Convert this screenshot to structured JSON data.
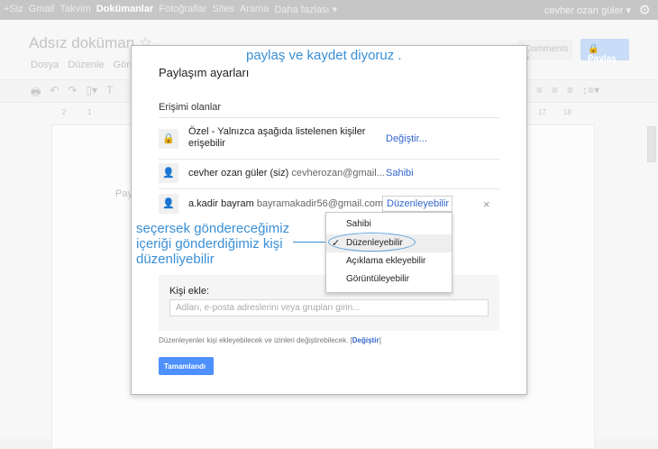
{
  "topbar": {
    "items": [
      "+Siz",
      "Gmail",
      "Takvim",
      "Dokümanlar",
      "Fotoğraflar",
      "Sites",
      "Arama",
      "Daha fazlası ▾"
    ],
    "account": "cevher ozan güler ▾",
    "settings_icon": "gear-icon"
  },
  "doc": {
    "title": "Adsız doküman",
    "star": "☆",
    "menus": [
      "Dosya",
      "Düzenle",
      "Görün"
    ],
    "comments": "Comments ▾",
    "share": "Paylaş",
    "ruler": [
      "2",
      "1",
      "17",
      "18"
    ],
    "page_text": "Pay"
  },
  "annotation_top": "paylaş ve kaydet diyoruz .",
  "annotation_side": [
    "seçersek göndereceğimiz",
    "içeriği gönderdiğimiz kişi",
    "düzenliyebilir"
  ],
  "dialog": {
    "title": "Paylaşım ayarları",
    "section": "Erişimi olanlar",
    "rows": [
      {
        "name": "Özel - Yalnızca aşağıda listelenen kişiler",
        "name2": "erişebilir",
        "action": "Değiştir..."
      },
      {
        "name": "cevher ozan güler (siz)",
        "email": "cevherozan@gmail...",
        "action": "Sahibi"
      },
      {
        "name": "a.kadir bayram",
        "email": "bayramakadir56@gmail.com",
        "action": "Düzenleyebilir ▾"
      }
    ],
    "dropdown": {
      "options": [
        "Sahibi",
        "Düzenleyebilir",
        "Açıklama ekleyebilir",
        "Görüntüleyebilir"
      ],
      "selected": "Düzenleyebilir"
    },
    "add_label": "Kişi ekle:",
    "add_placeholder": "Adları, e-posta adreslerini veya grupları girin...",
    "note": "Düzenleyenler kişi ekleyebilecek ve izinleri değiştirebilecek. [",
    "note_link": "Değiştir",
    "note_end": "]",
    "done": "Tamamlandı",
    "remove": "×"
  },
  "colors": {
    "accent": "#4d90fe",
    "annotation": "#3a8fd6",
    "link": "#3366cc"
  }
}
